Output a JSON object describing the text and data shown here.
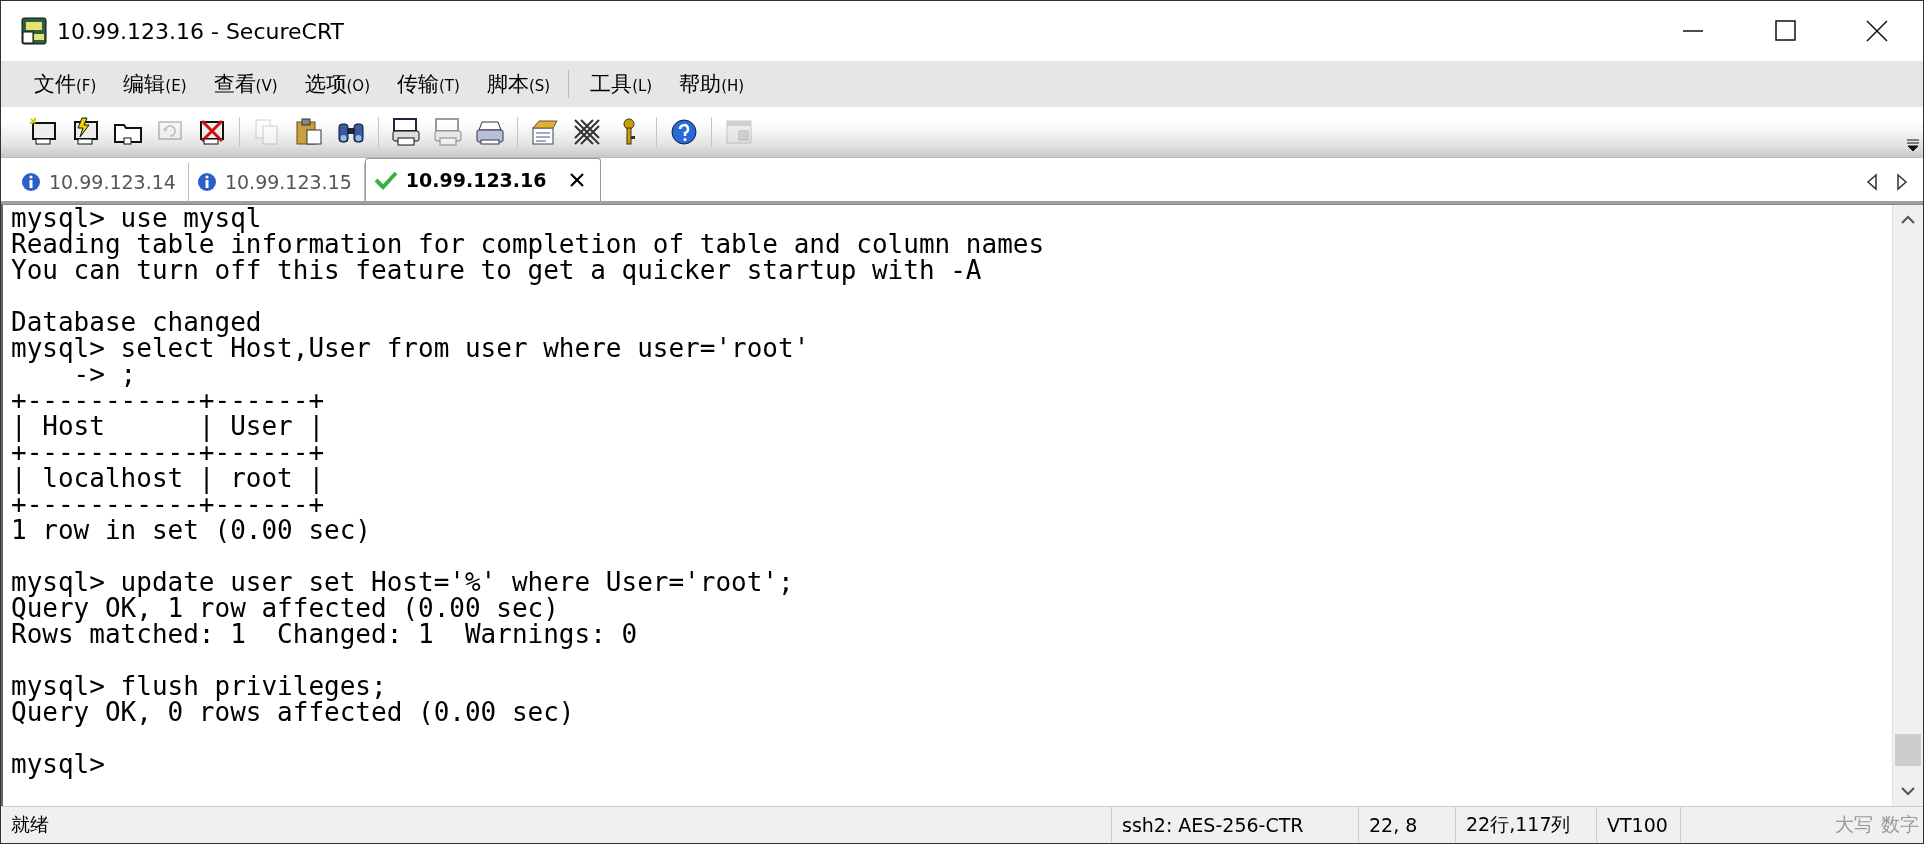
{
  "window": {
    "title": "10.99.123.16 - SecureCRT"
  },
  "menu": [
    {
      "kind": "item",
      "label": "文件",
      "key": "(F)"
    },
    {
      "kind": "item",
      "label": "编辑",
      "key": "(E)"
    },
    {
      "kind": "item",
      "label": "查看",
      "key": "(V)"
    },
    {
      "kind": "item",
      "label": "选项",
      "key": "(O)"
    },
    {
      "kind": "item",
      "label": "传输",
      "key": "(T)"
    },
    {
      "kind": "item",
      "label": "脚本",
      "key": "(S)"
    },
    {
      "kind": "separator"
    },
    {
      "kind": "item",
      "label": "工具",
      "key": "(L)"
    },
    {
      "kind": "item",
      "label": "帮助",
      "key": "(H)"
    }
  ],
  "toolbar": [
    {
      "kind": "connect",
      "disabled": false
    },
    {
      "kind": "quick",
      "disabled": false
    },
    {
      "kind": "folder",
      "disabled": false
    },
    {
      "kind": "reconnect",
      "disabled": true
    },
    {
      "kind": "disconnect",
      "disabled": false
    },
    {
      "kind": "separator"
    },
    {
      "kind": "copy",
      "disabled": true
    },
    {
      "kind": "paste",
      "disabled": false
    },
    {
      "kind": "find",
      "disabled": false
    },
    {
      "kind": "separator"
    },
    {
      "kind": "print",
      "disabled": false
    },
    {
      "kind": "print",
      "disabled": true
    },
    {
      "kind": "printer",
      "disabled": false
    },
    {
      "kind": "separator"
    },
    {
      "kind": "options",
      "disabled": false
    },
    {
      "kind": "keymap",
      "disabled": false
    },
    {
      "kind": "key",
      "disabled": false
    },
    {
      "kind": "separator"
    },
    {
      "kind": "help",
      "disabled": false
    },
    {
      "kind": "separator"
    },
    {
      "kind": "window",
      "disabled": true
    }
  ],
  "tabs": [
    {
      "label": "10.99.123.14",
      "kind": "info",
      "selected": false
    },
    {
      "label": "10.99.123.15",
      "kind": "info",
      "selected": false
    },
    {
      "label": "10.99.123.16",
      "kind": "connected",
      "selected": true
    }
  ],
  "terminal": {
    "lines": [
      {
        "kind": "text",
        "text": "mysql> use mysql"
      },
      {
        "kind": "text",
        "text": "Reading table information for completion of table and column names"
      },
      {
        "kind": "text",
        "text": "You can turn off this feature to get a quicker startup with -A"
      },
      {
        "kind": "blank"
      },
      {
        "kind": "text",
        "text": "Database changed"
      },
      {
        "kind": "text",
        "text": "mysql> select Host,User from user where user='root'"
      },
      {
        "kind": "text",
        "text": "    -> ;"
      },
      {
        "kind": "text",
        "text": "+-----------+------+"
      },
      {
        "kind": "text",
        "text": "| Host      | User |"
      },
      {
        "kind": "text",
        "text": "+-----------+------+"
      },
      {
        "kind": "text",
        "text": "| localhost | root |"
      },
      {
        "kind": "text",
        "text": "+-----------+------+"
      },
      {
        "kind": "text",
        "text": "1 row in set (0.00 sec)"
      },
      {
        "kind": "blank"
      },
      {
        "kind": "text",
        "text": "mysql> update user set Host='%' where User='root';"
      },
      {
        "kind": "text",
        "text": "Query OK, 1 row affected (0.00 sec)"
      },
      {
        "kind": "text",
        "text": "Rows matched: 1  Changed: 1  Warnings: 0"
      },
      {
        "kind": "blank"
      },
      {
        "kind": "text",
        "text": "mysql> flush privileges;"
      },
      {
        "kind": "text",
        "text": "Query OK, 0 rows affected (0.00 sec)"
      },
      {
        "kind": "blank"
      },
      {
        "kind": "text",
        "text": "mysql>"
      }
    ]
  },
  "status_bar": [
    {
      "text": "就绪",
      "kind": "message",
      "disabled": false
    },
    {
      "text": "ssh2: AES-256-CTR",
      "kind": "field",
      "disabled": false
    },
    {
      "text": "22,  8",
      "kind": "field",
      "disabled": false
    },
    {
      "text": "22行,117列",
      "kind": "field",
      "disabled": false
    },
    {
      "text": "VT100",
      "kind": "field",
      "disabled": false
    },
    {
      "text": "大写",
      "kind": "indicator",
      "disabled": true
    },
    {
      "text": "数字",
      "kind": "indicator",
      "disabled": true
    }
  ]
}
